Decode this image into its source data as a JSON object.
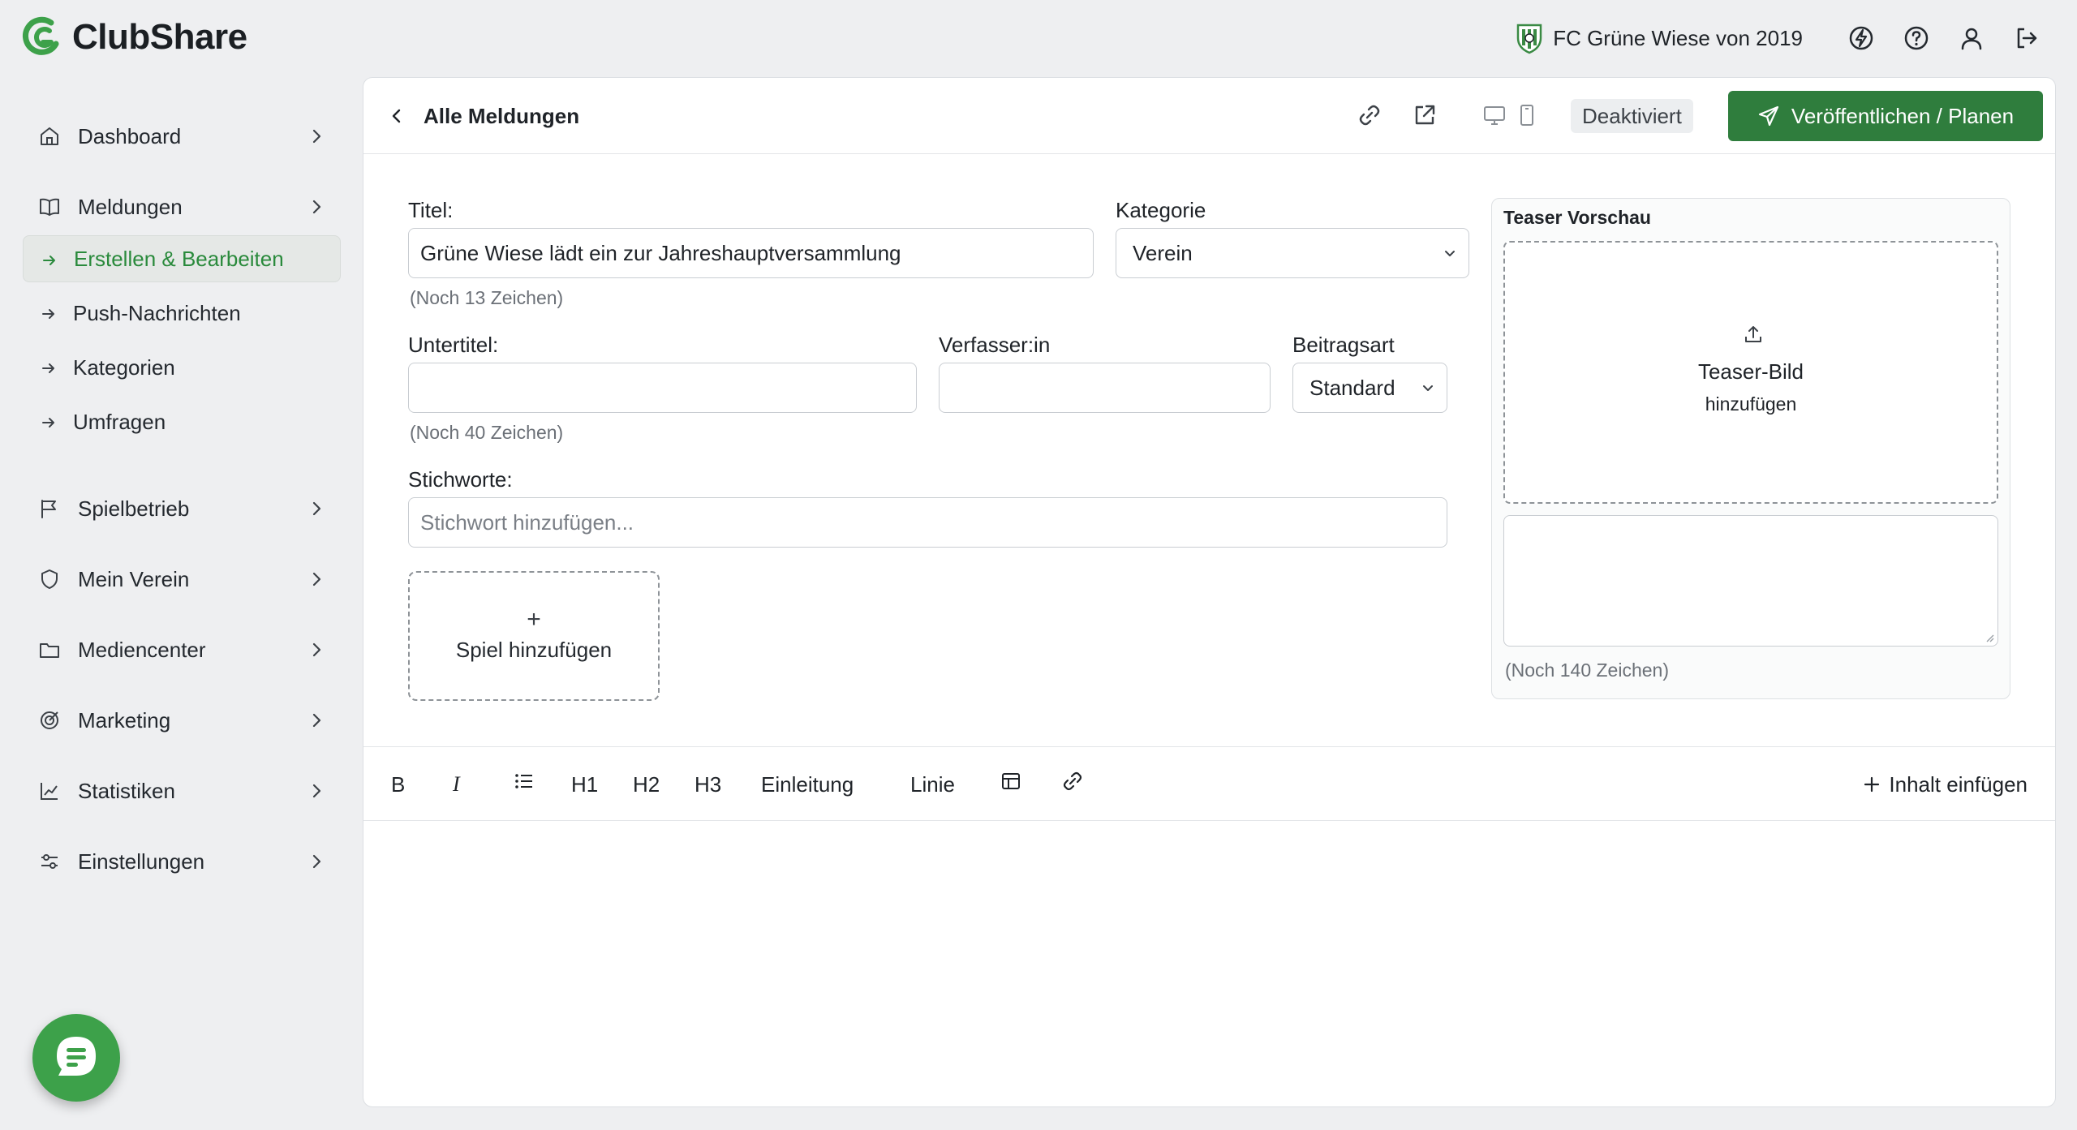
{
  "brand": {
    "name": "ClubShare",
    "color": "#3da14a"
  },
  "topbar": {
    "club_name": "FC Grüne Wiese von 2019",
    "icons": [
      "club-crest-icon",
      "bolt-icon",
      "help-icon",
      "user-icon",
      "logout-icon"
    ]
  },
  "sidebar": {
    "items": [
      {
        "label": "Dashboard",
        "icon": "home-icon"
      },
      {
        "label": "Meldungen",
        "icon": "book-icon"
      },
      {
        "label": "Spielbetrieb",
        "icon": "flag-icon"
      },
      {
        "label": "Mein Verein",
        "icon": "shield-icon"
      },
      {
        "label": "Mediencenter",
        "icon": "folder-icon"
      },
      {
        "label": "Marketing",
        "icon": "target-icon"
      },
      {
        "label": "Statistiken",
        "icon": "chart-icon"
      },
      {
        "label": "Einstellungen",
        "icon": "sliders-icon"
      }
    ],
    "subitems": [
      {
        "label": "Erstellen & Bearbeiten",
        "active": true
      },
      {
        "label": "Push-Nachrichten",
        "active": false
      },
      {
        "label": "Kategorien",
        "active": false
      },
      {
        "label": "Umfragen",
        "active": false
      }
    ]
  },
  "header": {
    "back_title": "Alle Meldungen",
    "status_badge": "Deaktiviert",
    "publish_label": "Veröffentlichen / Planen"
  },
  "form": {
    "title_label": "Titel:",
    "title_value": "Grüne Wiese lädt ein zur Jahreshauptversammlung",
    "title_hint": "(Noch 13 Zeichen)",
    "category_label": "Kategorie",
    "category_value": "Verein",
    "subtitle_label": "Untertitel:",
    "subtitle_value": "",
    "subtitle_hint": "(Noch 40 Zeichen)",
    "author_label": "Verfasser:in",
    "author_value": "",
    "type_label": "Beitragsart",
    "type_value": "Standard",
    "tags_label": "Stichworte:",
    "tags_placeholder": "Stichwort hinzufügen...",
    "add_game_label": "Spiel hinzufügen"
  },
  "teaser": {
    "title": "Teaser Vorschau",
    "image_label_1": "Teaser-Bild",
    "image_label_2": "hinzufügen",
    "text_hint": "(Noch 140 Zeichen)"
  },
  "editor": {
    "bold": "B",
    "italic": "I",
    "h1": "H1",
    "h2": "H2",
    "h3": "H3",
    "intro": "Einleitung",
    "line": "Linie",
    "insert_label": "Inhalt einfügen"
  },
  "colors": {
    "primary_button": "#2f7d3d",
    "active_text": "#2a8a3c",
    "background": "#eeeff1"
  }
}
